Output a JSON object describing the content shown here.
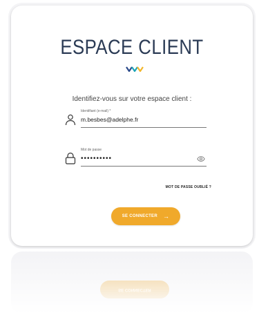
{
  "title": "ESPACE CLIENT",
  "subtitle": "Identifiez-vous sur votre espace client :",
  "email": {
    "label": "Identifiant (e-mail) *",
    "value": "m.besbes@adelphe.fr"
  },
  "password": {
    "label": "Mot de passe",
    "value": "••••••••••"
  },
  "forgot_label": "MOT DE PASSE OUBLIÉ ?",
  "submit": {
    "label": "SE CONNECTER",
    "arrow": "→"
  },
  "colors": {
    "title": "#2b3b55",
    "accent": "#f0a92b",
    "logo_blue": "#2b4a8a",
    "logo_teal": "#1ca5b8",
    "logo_yellow": "#f2b62a"
  },
  "icons": {
    "email": "user-icon",
    "password": "lock-icon",
    "visibility": "eye-icon",
    "button": "arrow-right-icon"
  }
}
